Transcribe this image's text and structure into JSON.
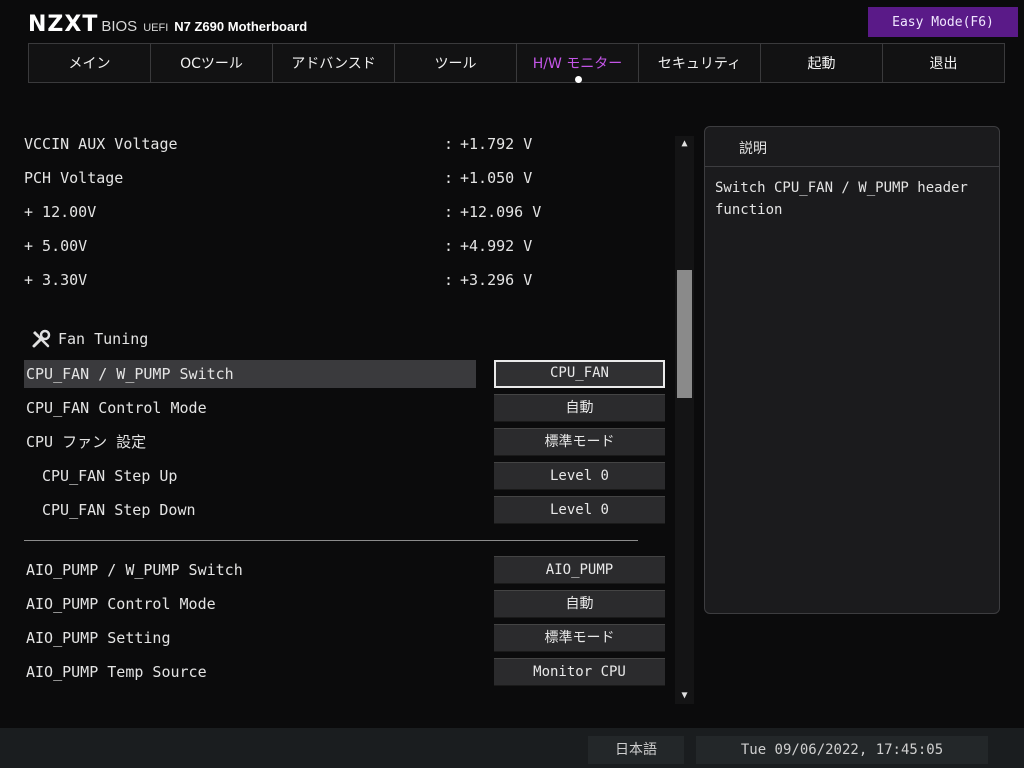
{
  "brand": {
    "logo": "NZXT",
    "bios": "BIOS",
    "uefi": "UEFI",
    "model": "N7 Z690 Motherboard"
  },
  "easy_mode_label": "Easy Mode(F6)",
  "tabs": [
    {
      "label": "メイン"
    },
    {
      "label": "OCツール"
    },
    {
      "label": "アドバンスド"
    },
    {
      "label": "ツール"
    },
    {
      "label": "H/W モニター",
      "active": true
    },
    {
      "label": "セキュリティ"
    },
    {
      "label": "起動"
    },
    {
      "label": "退出"
    }
  ],
  "voltages": [
    {
      "label": "VCCIN AUX Voltage",
      "value": "+1.792 V"
    },
    {
      "label": "PCH Voltage",
      "value": "+1.050 V"
    },
    {
      "label": "+ 12.00V",
      "value": "+12.096 V"
    },
    {
      "label": "+ 5.00V",
      "value": "+4.992 V"
    },
    {
      "label": "+ 3.30V",
      "value": "+3.296 V"
    }
  ],
  "colon": ":",
  "section_title": "Fan Tuning",
  "fan_items": [
    {
      "label": "CPU_FAN / W_PUMP Switch",
      "value": "CPU_FAN",
      "selected": true
    },
    {
      "label": "CPU_FAN Control Mode",
      "value": "自動"
    },
    {
      "label": "CPU ファン 設定",
      "value": "標準モード"
    },
    {
      "label": "CPU_FAN Step Up",
      "value": "Level 0",
      "indent": true
    },
    {
      "label": "CPU_FAN Step Down",
      "value": "Level 0",
      "indent": true
    }
  ],
  "pump_items": [
    {
      "label": "AIO_PUMP / W_PUMP Switch",
      "value": "AIO_PUMP"
    },
    {
      "label": "AIO_PUMP Control Mode",
      "value": "自動"
    },
    {
      "label": "AIO_PUMP Setting",
      "value": "標準モード"
    },
    {
      "label": "AIO_PUMP Temp Source",
      "value": "Monitor CPU"
    }
  ],
  "help": {
    "title": "説明",
    "text": "Switch CPU_FAN / W_PUMP header\nfunction"
  },
  "scroll": {
    "up": "▲",
    "down": "▼"
  },
  "footer": {
    "language": "日本語",
    "datetime": "Tue 09/06/2022, 17:45:05"
  },
  "colors": {
    "accent": "#c455e8",
    "easy_mode_bg": "#5a1a88"
  },
  "icons": {
    "section": "wrench-screwdriver-icon"
  }
}
